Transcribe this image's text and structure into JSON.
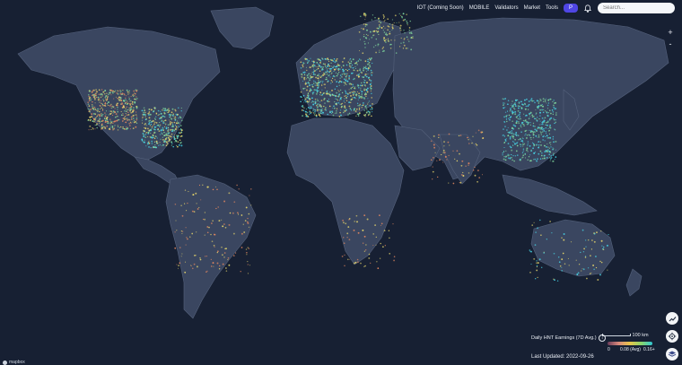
{
  "nav": {
    "links": [
      "IOT (Coming Soon)",
      "MOBILE",
      "Validators",
      "Market",
      "Tools"
    ],
    "wallet_label": "P",
    "search_placeholder": "Search..."
  },
  "zoom": {
    "in": "+",
    "out": "-"
  },
  "legend": {
    "title": "Daily HNT Earnings (7D Avg.)",
    "info": "i",
    "scale_label": "100 km",
    "ticks": [
      "0",
      "0.08 (Avg)",
      "0.16+"
    ],
    "colors": [
      "#6b3b59",
      "#d9897b",
      "#e8c54a",
      "#8bd46a",
      "#2fc7d4"
    ]
  },
  "last_updated": "Last Updated: 2022-09-26",
  "attribution": "mapbox",
  "colors": {
    "ocean": "#172033",
    "land": "#3a4660",
    "hotspot_yellow": "#e3d36b",
    "hotspot_green": "#7ed39b",
    "hotspot_cyan": "#47d4e6",
    "hotspot_orange": "#e2875f"
  }
}
